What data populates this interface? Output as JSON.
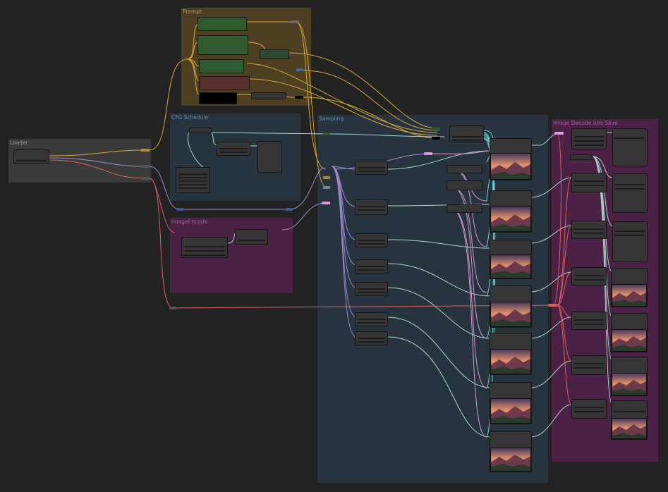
{
  "groups": {
    "loader": {
      "title": "Loader",
      "color": "#3a3a3a",
      "title_color": "#9a9a9a"
    },
    "prompt": {
      "title": "Prompt",
      "color": "#4e3f22",
      "title_color": "#b49a5e"
    },
    "cfg_schedule": {
      "title": "CFG Schedule",
      "color": "#26343f",
      "title_color": "#5f8cb0"
    },
    "image_encode": {
      "title": "ImageEncode",
      "color": "#4b2146",
      "title_color": "#a35e9d"
    },
    "sampling": {
      "title": "Sampling",
      "color": "#27343f",
      "title_color": "#5f8cb0"
    },
    "image_decode": {
      "title": "Image Decode and Save",
      "color": "#4b2146",
      "title_color": "#a35e9d"
    }
  },
  "colors": {
    "canvas_bg": "#222222",
    "node_bg": "#353535",
    "wire_model": "#d8a83a",
    "wire_clip": "#d8a83a",
    "wire_vae": "#e06060",
    "wire_latent": "#d89ad8",
    "wire_cond": "#a8d8c8",
    "wire_image": "#6ad8d8",
    "wire_purple": "#a08ad0",
    "prompt_positive": "#2f5a2f",
    "prompt_negative": "#5a2f2f"
  },
  "icons": {
    "image_preview": "landscape-thumbnail-icon"
  }
}
